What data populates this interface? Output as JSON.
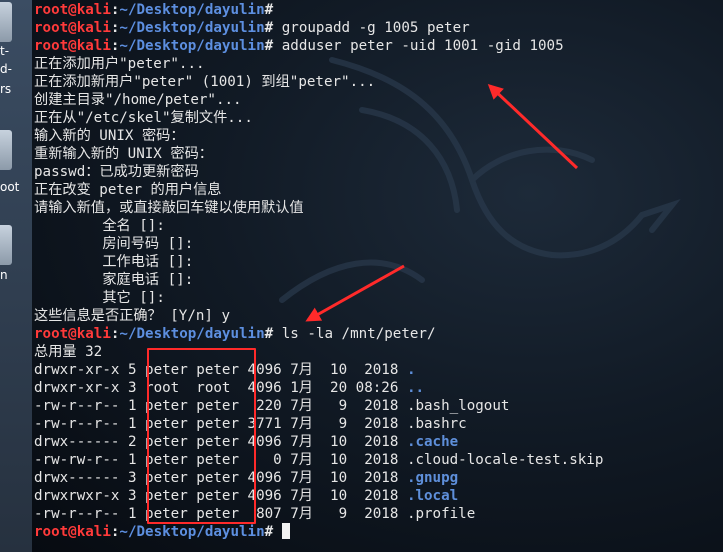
{
  "desktop": {
    "labels": [
      "t-",
      "d-",
      "rs",
      "oot",
      "n"
    ]
  },
  "prompt": {
    "user": "root@kali",
    "path_sep": ":",
    "path": "~/Desktop/dayulin",
    "symbol": "# "
  },
  "commands": {
    "groupadd": "groupadd -g 1005 peter",
    "adduser": "adduser peter -uid 1001 -gid 1005",
    "ls": "ls -la /mnt/peter/"
  },
  "adduser_output": [
    "正在添加用户\"peter\"...",
    "正在添加新用户\"peter\" (1001) 到组\"peter\"...",
    "创建主目录\"/home/peter\"...",
    "正在从\"/etc/skel\"复制文件...",
    "输入新的 UNIX 密码：",
    "重新输入新的 UNIX 密码：",
    "passwd：已成功更新密码",
    "正在改变 peter 的用户信息",
    "请输入新值，或直接敲回车键以使用默认值",
    "        全名 []:",
    "        房间号码 []:",
    "        工作电话 []:",
    "        家庭电话 []:",
    "        其它 []:",
    "这些信息是否正确？ [Y/n] y"
  ],
  "ls_total": "总用量 32",
  "ls_rows": [
    {
      "meta": "drwxr-xr-x 5 peter peter 4096 7月  10  2018 ",
      "name": ".",
      "dir": true
    },
    {
      "meta": "drwxr-xr-x 3 root  root  4096 1月  20 08:26 ",
      "name": "..",
      "dir": true
    },
    {
      "meta": "-rw-r--r-- 1 peter peter  220 7月   9  2018 ",
      "name": ".bash_logout",
      "dir": false
    },
    {
      "meta": "-rw-r--r-- 1 peter peter 3771 7月   9  2018 ",
      "name": ".bashrc",
      "dir": false
    },
    {
      "meta": "drwx------ 2 peter peter 4096 7月  10  2018 ",
      "name": ".cache",
      "dir": true
    },
    {
      "meta": "-rw-rw-r-- 1 peter peter    0 7月  10  2018 ",
      "name": ".cloud-locale-test.skip",
      "dir": false
    },
    {
      "meta": "drwx------ 3 peter peter 4096 7月  10  2018 ",
      "name": ".gnupg",
      "dir": true
    },
    {
      "meta": "drwxrwxr-x 3 peter peter 4096 7月  10  2018 ",
      "name": ".local",
      "dir": true
    },
    {
      "meta": "-rw-r--r-- 1 peter peter  807 7月   9  2018 ",
      "name": ".profile",
      "dir": false
    }
  ],
  "colors": {
    "prompt_user": "#ff3a3a",
    "prompt_path": "#5d8fe0",
    "directory": "#5e8fda",
    "annotation": "#ff2a2a",
    "terminal_bg": "#0b111a"
  }
}
